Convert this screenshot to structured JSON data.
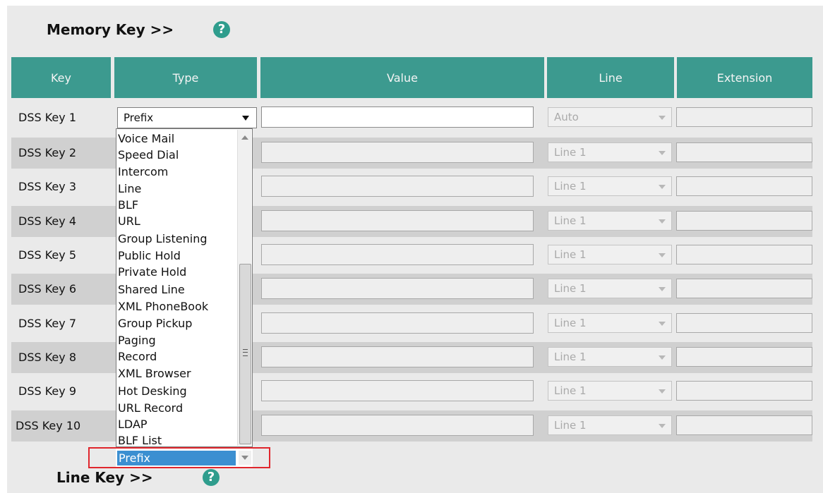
{
  "memory_key": {
    "title": "Memory Key >>",
    "help": "?"
  },
  "line_key": {
    "title": "Line Key >>",
    "help": "?"
  },
  "table": {
    "headers": {
      "key": "Key",
      "type": "Type",
      "value": "Value",
      "line": "Line",
      "extension": "Extension"
    },
    "rows": [
      {
        "key": "DSS Key 1",
        "line": "Auto"
      },
      {
        "key": "DSS Key 2",
        "line": "Line 1"
      },
      {
        "key": "DSS Key 3",
        "line": "Line 1"
      },
      {
        "key": "DSS Key 4",
        "line": "Line 1"
      },
      {
        "key": "DSS Key 5",
        "line": "Line 1"
      },
      {
        "key": "DSS Key 6",
        "line": "Line 1"
      },
      {
        "key": "DSS Key 7",
        "line": "Line 1"
      },
      {
        "key": "DSS Key 8",
        "line": "Line 1"
      },
      {
        "key": "DSS Key 9",
        "line": "Line 1"
      },
      {
        "key": "DSS Key 10",
        "line": "Line 1"
      }
    ]
  },
  "type_select": {
    "selected": "Prefix",
    "options": [
      "Voice Mail",
      "Speed Dial",
      "Intercom",
      "Line",
      "BLF",
      "URL",
      "Group Listening",
      "Public Hold",
      "Private Hold",
      "Shared Line",
      "XML PhoneBook",
      "Group Pickup",
      "Paging",
      "Record",
      "XML Browser",
      "Hot Desking",
      "URL Record",
      "LDAP",
      "BLF List"
    ],
    "highlighted": "Prefix"
  },
  "colors": {
    "header_bg": "#3c9a8f",
    "highlight": "#3b8fd1",
    "callout_border": "#e0262d",
    "help_icon": "#2f9d8d"
  }
}
